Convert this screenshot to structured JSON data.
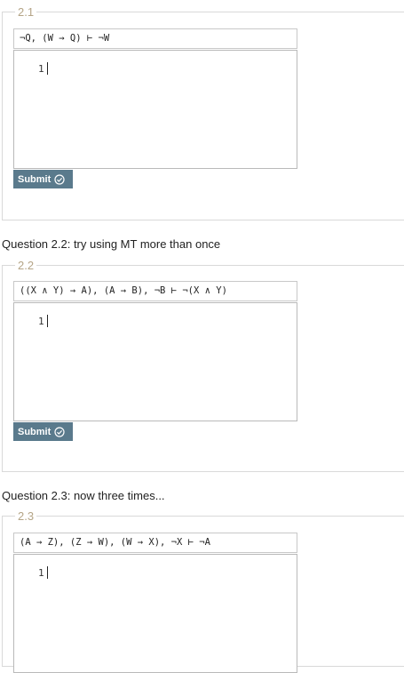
{
  "exercises": [
    {
      "legend": "2.1",
      "problem": "¬Q, (W → Q) ⊢ ¬W",
      "line_number": "1",
      "submit_label": "Submit"
    },
    {
      "question": "Question 2.2: try using MT more than once",
      "legend": "2.2",
      "problem": "((X ∧ Y) → A), (A → B), ¬B ⊢ ¬(X ∧ Y)",
      "line_number": "1",
      "submit_label": "Submit"
    },
    {
      "question": "Question 2.3: now three times...",
      "legend": "2.3",
      "problem": "(A → Z), (Z → W), (W → X), ¬X ⊢ ¬A",
      "line_number": "1"
    }
  ]
}
